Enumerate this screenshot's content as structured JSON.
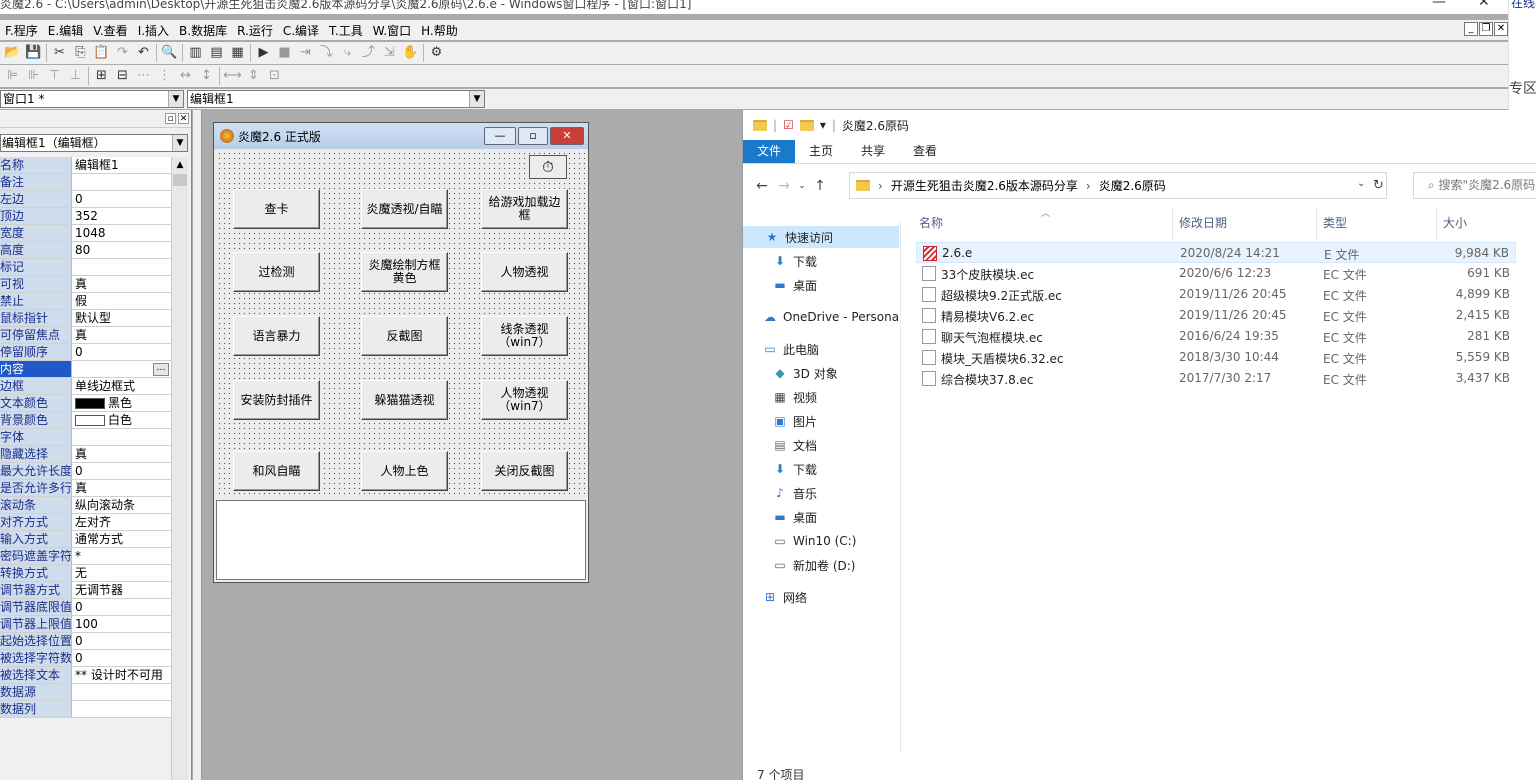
{
  "ide": {
    "title_bar": "炎魔2.6 - C:\\Users\\admin\\Desktop\\开源生死狙击炎魔2.6版本源码分享\\炎魔2.6原码\\2.6.e - Windows窗口程序 - [窗口:窗口1]",
    "window_controls": [
      "—",
      "□",
      "✕"
    ],
    "menu": [
      "F.程序",
      "E.编辑",
      "V.查看",
      "I.插入",
      "B.数据库",
      "R.运行",
      "C.编译",
      "T.工具",
      "W.窗口",
      "H.帮助"
    ],
    "window_combo": "窗口1 *",
    "control_combo": "编辑框1",
    "property_panel": {
      "object_combo": "编辑框1（编辑框）",
      "rows": [
        {
          "name": "名称",
          "value": "编辑框1"
        },
        {
          "name": "备注",
          "value": ""
        },
        {
          "name": "左边",
          "value": "0"
        },
        {
          "name": "顶边",
          "value": "352"
        },
        {
          "name": "宽度",
          "value": "1048"
        },
        {
          "name": "高度",
          "value": "80"
        },
        {
          "name": "标记",
          "value": ""
        },
        {
          "name": "可视",
          "value": "真"
        },
        {
          "name": "禁止",
          "value": "假"
        },
        {
          "name": "鼠标指针",
          "value": "默认型"
        },
        {
          "name": "可停留焦点",
          "value": "真"
        },
        {
          "name": "停留顺序",
          "value": "0"
        },
        {
          "name": "内容",
          "value": "…"
        },
        {
          "name": "边框",
          "value": "单线边框式"
        },
        {
          "name": "文本颜色",
          "value": "黑色",
          "swatch": "#000000"
        },
        {
          "name": "背景颜色",
          "value": "白色",
          "swatch": "#ffffff"
        },
        {
          "name": "字体",
          "value": ""
        },
        {
          "name": "隐藏选择",
          "value": "真"
        },
        {
          "name": "最大允许长度",
          "value": "0"
        },
        {
          "name": "是否允许多行",
          "value": "真"
        },
        {
          "name": "滚动条",
          "value": "纵向滚动条"
        },
        {
          "name": "对齐方式",
          "value": "左对齐"
        },
        {
          "name": "输入方式",
          "value": "通常方式"
        },
        {
          "name": "密码遮盖字符",
          "value": "*"
        },
        {
          "name": "转换方式",
          "value": "无"
        },
        {
          "name": "调节器方式",
          "value": "无调节器"
        },
        {
          "name": "调节器底限值",
          "value": "0"
        },
        {
          "name": "调节器上限值",
          "value": "100"
        },
        {
          "name": "起始选择位置",
          "value": "0"
        },
        {
          "name": "被选择字符数",
          "value": "0"
        },
        {
          "name": "被选择文本",
          "value": "** 设计时不可用"
        },
        {
          "name": "数据源",
          "value": ""
        },
        {
          "name": "数据列",
          "value": ""
        }
      ]
    },
    "designed_form": {
      "title": "炎魔2.6 正式版",
      "timer_icon": "⏱",
      "buttons": [
        "查卡",
        "炎魔透视/自瞄",
        "给游戏加载边框",
        "过检测",
        "炎魔绘制方框黄色",
        "人物透视",
        "语言暴力",
        "反截图",
        "线条透视（win7）",
        "安装防封插件",
        "躲猫猫透视",
        "人物透视（win7）",
        "和风自瞄",
        "人物上色",
        "关闭反截图"
      ]
    }
  },
  "explorer": {
    "title": "炎魔2.6原码",
    "tabs": [
      "文件",
      "主页",
      "共享",
      "查看"
    ],
    "breadcrumb": [
      "开源生死狙击炎魔2.6版本源码分享",
      "炎魔2.6原码"
    ],
    "search_placeholder": "搜索\"炎魔2.6原码\"",
    "nav": [
      {
        "label": "快速访问",
        "icon": "★"
      },
      {
        "label": "下载",
        "icon": "⬇"
      },
      {
        "label": "桌面",
        "icon": "▬"
      },
      {
        "label": "OneDrive - Persona",
        "icon": "☁"
      },
      {
        "label": "此电脑",
        "icon": "▭"
      },
      {
        "label": "3D 对象",
        "icon": "◆"
      },
      {
        "label": "视频",
        "icon": "▦"
      },
      {
        "label": "图片",
        "icon": "▣"
      },
      {
        "label": "文档",
        "icon": "▤"
      },
      {
        "label": "下载",
        "icon": "⬇"
      },
      {
        "label": "音乐",
        "icon": "♪"
      },
      {
        "label": "桌面",
        "icon": "▬"
      },
      {
        "label": "Win10 (C:)",
        "icon": "▭"
      },
      {
        "label": "新加卷 (D:)",
        "icon": "▭"
      },
      {
        "label": "网络",
        "icon": "⊞"
      }
    ],
    "columns": [
      "名称",
      "修改日期",
      "类型",
      "大小"
    ],
    "files": [
      {
        "name": "2.6.e",
        "date": "2020/8/24 14:21",
        "type": "E 文件",
        "size": "9,984 KB"
      },
      {
        "name": "33个皮肤模块.ec",
        "date": "2020/6/6 12:23",
        "type": "EC 文件",
        "size": "691 KB"
      },
      {
        "name": "超级模块9.2正式版.ec",
        "date": "2019/11/26 20:45",
        "type": "EC 文件",
        "size": "4,899 KB"
      },
      {
        "name": "精易模块V6.2.ec",
        "date": "2019/11/26 20:45",
        "type": "EC 文件",
        "size": "2,415 KB"
      },
      {
        "name": "聊天气泡框模块.ec",
        "date": "2016/6/24 19:35",
        "type": "EC 文件",
        "size": "281 KB"
      },
      {
        "name": "模块_天盾模块6.32.ec",
        "date": "2018/3/30 10:44",
        "type": "EC 文件",
        "size": "5,559 KB"
      },
      {
        "name": "综合模块37.8.ec",
        "date": "2017/7/30 2:17",
        "type": "EC 文件",
        "size": "3,437 KB"
      }
    ],
    "status": "7 个项目"
  },
  "right_edge": {
    "top_text": "在线视",
    "mid_text": "专区"
  }
}
